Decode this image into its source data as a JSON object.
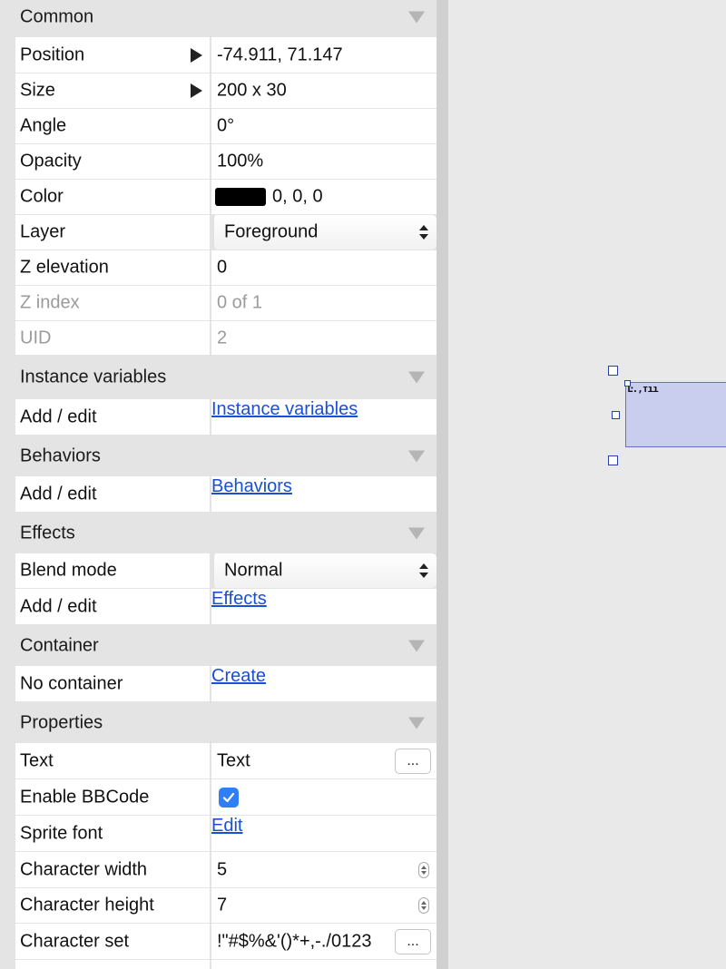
{
  "sections": {
    "common": "Common",
    "instance_variables": "Instance variables",
    "behaviors": "Behaviors",
    "effects": "Effects",
    "container": "Container",
    "properties": "Properties"
  },
  "common": {
    "position": {
      "label": "Position",
      "value": "-74.911, 71.147"
    },
    "size": {
      "label": "Size",
      "value": "200 x 30"
    },
    "angle": {
      "label": "Angle",
      "value": "0°"
    },
    "opacity": {
      "label": "Opacity",
      "value": "100%"
    },
    "color": {
      "label": "Color",
      "value": "0, 0, 0",
      "swatch": "#000000"
    },
    "layer": {
      "label": "Layer",
      "value": "Foreground"
    },
    "z_elevation": {
      "label": "Z elevation",
      "value": "0"
    },
    "z_index": {
      "label": "Z index",
      "value": "0 of 1"
    },
    "uid": {
      "label": "UID",
      "value": "2"
    }
  },
  "instance_variables": {
    "label": "Add / edit",
    "link": "Instance variables"
  },
  "behaviors": {
    "label": "Add / edit",
    "link": "Behaviors"
  },
  "effects": {
    "blend_mode": {
      "label": "Blend mode",
      "value": "Normal"
    },
    "add_edit": {
      "label": "Add / edit",
      "link": "Effects"
    }
  },
  "container": {
    "label": "No container",
    "link": "Create"
  },
  "properties": {
    "text": {
      "label": "Text",
      "value": "Text",
      "button": "..."
    },
    "enable_bbcode": {
      "label": "Enable BBCode",
      "checked": true
    },
    "sprite_font": {
      "label": "Sprite font",
      "link": "Edit"
    },
    "character_width": {
      "label": "Character width",
      "value": "5"
    },
    "character_height": {
      "label": "Character height",
      "value": "7"
    },
    "character_set": {
      "label": "Character set",
      "value": "!\"#$%&'()*+,-./0123",
      "button": "..."
    }
  },
  "canvas": {
    "glyph_text": "Ŀ.,ᴛıı"
  },
  "colors": {
    "panel_bg": "#e4e4e4",
    "cell_bg": "#ffffff",
    "link": "#1a4fd6",
    "checkbox": "#2f7ef6",
    "selection_fill": "#c9cdee",
    "selection_border": "#6470d0"
  }
}
